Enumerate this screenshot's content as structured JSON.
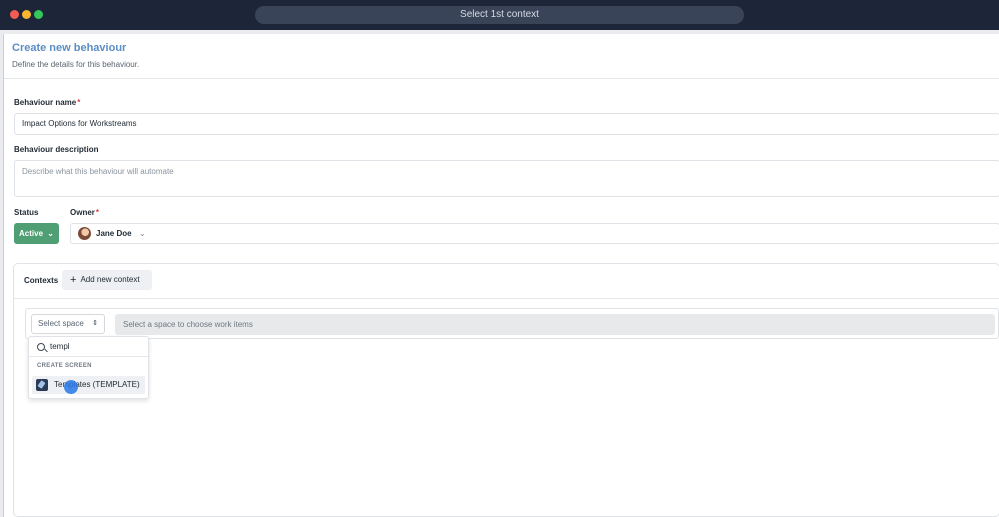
{
  "window": {
    "tab_title": "Select 1st context",
    "traffic_lights": [
      "#f25c54",
      "#f7b731",
      "#34c759"
    ]
  },
  "header": {
    "title": "Create new behaviour",
    "subtitle": "Define the details for this behaviour."
  },
  "form": {
    "name_label": "Behaviour name",
    "required_mark": "*",
    "name_value": "Impact Options for Workstreams",
    "description_label": "Behaviour description",
    "description_placeholder": "Describe what this behaviour will automate",
    "status_label": "Status",
    "status_value": "Active",
    "status_color": "#4f9e74",
    "owner_label": "Owner",
    "owner_value": "Jane Doe"
  },
  "contexts": {
    "label": "Contexts",
    "add_button": "Add new context",
    "space_select_placeholder": "Select space",
    "work_items_placeholder": "Select a space to choose work items"
  },
  "space_dropdown": {
    "search_query": "templ",
    "group_label": "CREATE SCREEN",
    "items": [
      {
        "label": "Templates (TEMPLATE)",
        "icon": "rocket-icon"
      }
    ]
  },
  "colors": {
    "title_accent": "#5b8ec4",
    "titlebar": "#1c2638",
    "cursor": "#2878e6"
  }
}
